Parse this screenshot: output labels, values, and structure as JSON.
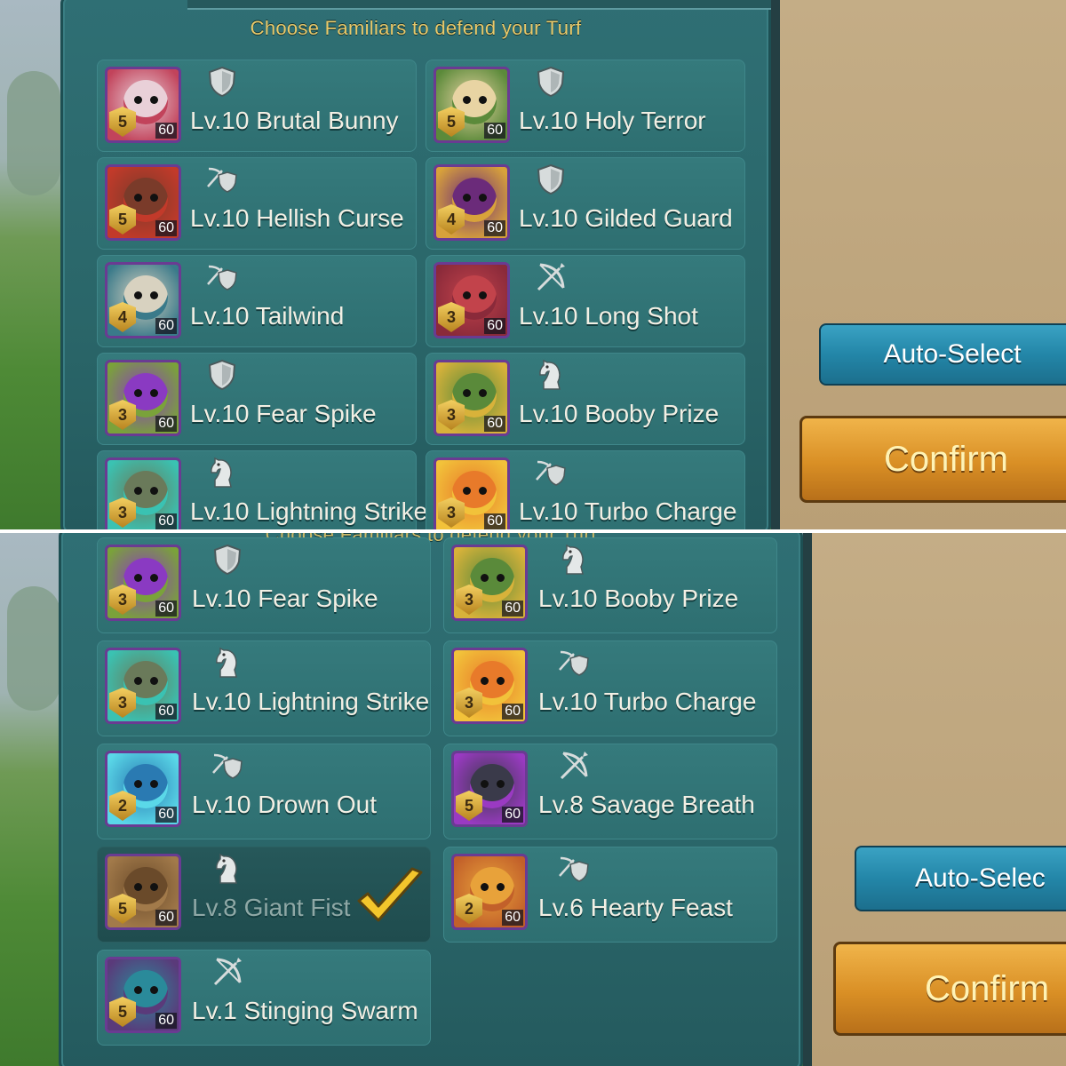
{
  "panel": {
    "title": "Choose Familiars to defend your Turf"
  },
  "buttons": {
    "auto_select": "Auto-Select",
    "auto_select_cropped": "Auto-Selec",
    "confirm": "Confirm",
    "confirm_cropped": "Confirm"
  },
  "class_icons": {
    "shield": "shield-icon",
    "bow": "bow-icon",
    "bow_shield": "bow-shield-icon",
    "horse": "knight-horse-icon"
  },
  "shot1": {
    "cards": [
      {
        "label": "Lv.10 Brutal Bunny",
        "stars": "5",
        "level": "60",
        "class": "shield",
        "colors": [
          "#e9d0d8",
          "#c2435b"
        ]
      },
      {
        "label": "Lv.10 Holy Terror",
        "stars": "5",
        "level": "60",
        "class": "shield",
        "colors": [
          "#e8d4a3",
          "#5b8a3a"
        ]
      },
      {
        "label": "Lv.10 Hellish Curse",
        "stars": "5",
        "level": "60",
        "class": "bow_shield",
        "colors": [
          "#7a3b2a",
          "#c23a2a"
        ]
      },
      {
        "label": "Lv.10 Gilded Guard",
        "stars": "4",
        "level": "60",
        "class": "shield",
        "colors": [
          "#6b2b7a",
          "#d8a23a"
        ]
      },
      {
        "label": "Lv.10 Tailwind",
        "stars": "4",
        "level": "60",
        "class": "bow_shield",
        "colors": [
          "#d8d2c0",
          "#3a7a8a"
        ]
      },
      {
        "label": "Lv.10 Long Shot",
        "stars": "3",
        "level": "60",
        "class": "bow",
        "colors": [
          "#c2434b",
          "#8a2a3a"
        ]
      },
      {
        "label": "Lv.10 Fear Spike",
        "stars": "3",
        "level": "60",
        "class": "shield",
        "colors": [
          "#8a3ac2",
          "#7aa23a"
        ]
      },
      {
        "label": "Lv.10 Booby Prize",
        "stars": "3",
        "level": "60",
        "class": "horse",
        "colors": [
          "#5a8a3a",
          "#d8b23a"
        ]
      },
      {
        "label": "Lv.10 Lightning Strike",
        "stars": "3",
        "level": "60",
        "class": "horse",
        "colors": [
          "#6a7a5a",
          "#3ac2b2"
        ]
      },
      {
        "label": "Lv.10 Turbo Charge",
        "stars": "3",
        "level": "60",
        "class": "bow_shield",
        "colors": [
          "#e87a2a",
          "#f2c23a"
        ]
      }
    ]
  },
  "shot2": {
    "cards": [
      {
        "label": "Lv.10 Fear Spike",
        "stars": "3",
        "level": "60",
        "class": "shield",
        "colors": [
          "#8a3ac2",
          "#7aa23a"
        ]
      },
      {
        "label": "Lv.10 Booby Prize",
        "stars": "3",
        "level": "60",
        "class": "horse",
        "colors": [
          "#5a8a3a",
          "#d8b23a"
        ]
      },
      {
        "label": "Lv.10 Lightning Strike",
        "stars": "3",
        "level": "60",
        "class": "horse",
        "colors": [
          "#6a7a5a",
          "#3ac2b2"
        ]
      },
      {
        "label": "Lv.10 Turbo Charge",
        "stars": "3",
        "level": "60",
        "class": "bow_shield",
        "colors": [
          "#e87a2a",
          "#f2c23a"
        ]
      },
      {
        "label": "Lv.10 Drown Out",
        "stars": "2",
        "level": "60",
        "class": "bow_shield",
        "colors": [
          "#2a7ab2",
          "#5ad8e8"
        ]
      },
      {
        "label": "Lv.8 Savage Breath",
        "stars": "5",
        "level": "60",
        "class": "bow",
        "colors": [
          "#3a3a4a",
          "#9a3ac2"
        ]
      },
      {
        "label": "Lv.8 Giant Fist",
        "stars": "5",
        "level": "60",
        "class": "horse",
        "colors": [
          "#6a4a2a",
          "#a27a4a"
        ],
        "selected": true
      },
      {
        "label": "Lv.6 Hearty Feast",
        "stars": "2",
        "level": "60",
        "class": "bow_shield",
        "colors": [
          "#e8a23a",
          "#c2602a"
        ]
      },
      {
        "label": "Lv.1 Stinging Swarm",
        "stars": "5",
        "level": "60",
        "class": "bow",
        "colors": [
          "#2a8a9a",
          "#5a3a7a"
        ]
      }
    ]
  }
}
